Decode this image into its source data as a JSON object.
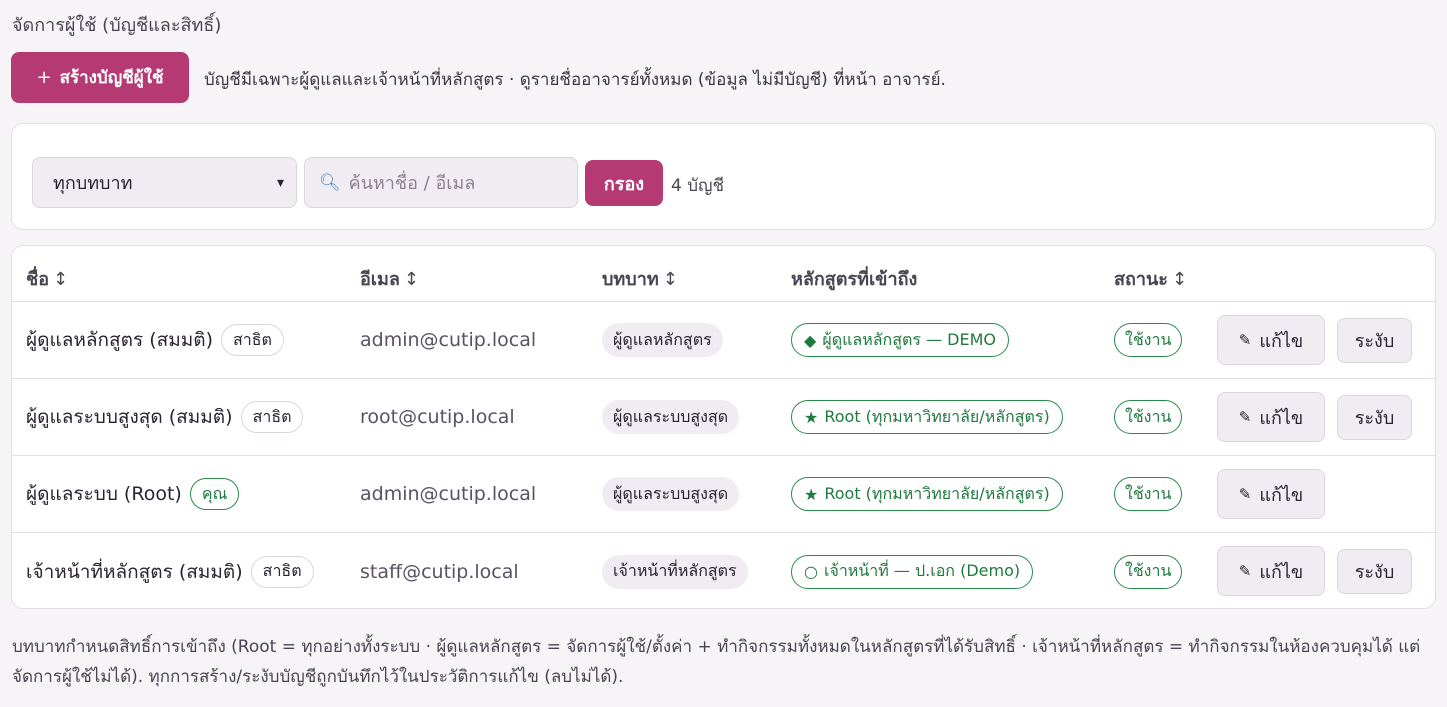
{
  "page": {
    "heading": "จัดการผู้ใช้ (บัญชีและสิทธิ์)",
    "create_icon": "plus-icon",
    "create_label": "สร้างบัญชีผู้ใช้",
    "intro": "บัญชีมีเฉพาะผู้ดูแลและเจ้าหน้าที่หลักสูตร · ดูรายชื่ออาจารย์ทั้งหมด (ข้อมูล ไม่มีบัญชี) ที่หน้า อาจารย์.",
    "footer": "บทบาทกำหนดสิทธิ์การเข้าถึง (Root = ทุกอย่างทั้งระบบ · ผู้ดูแลหลักสูตร = จัดการผู้ใช้/ตั้งค่า + ทำกิจกรรมทั้งหมดในหลักสูตรที่ได้รับสิทธิ์ · เจ้าหน้าที่หลักสูตร = ทำกิจกรรมในห้องควบคุมได้ แต่จัดการผู้ใช้ไม่ได้). ทุกการสร้าง/ระงับบัญชีถูกบันทึกไว้ในประวัติการแก้ไข (ลบไม่ได้)."
  },
  "filters": {
    "role_selected": "ทุกบทบาท",
    "search_placeholder": "ค้นหาชื่อ / อีเมล",
    "filter_label": "กรอง",
    "count": "4 บัญชี"
  },
  "table": {
    "headers": {
      "name": "ชื่อ",
      "email": "อีเมล",
      "role": "บทบาท",
      "courses": "หลักสูตรที่เข้าถึง",
      "status": "สถานะ",
      "sort_glyph": "↕"
    },
    "edit_label": "แก้ไข",
    "suspend_label": "ระงับ",
    "rows": [
      {
        "name": "ผู้ดูแลหลักสูตร (สมมติ)",
        "tag": "สาธิต",
        "email": "admin@cutip.local",
        "role": "ผู้ดูแลหลักสูตร",
        "course_glyph": "◆",
        "course": "ผู้ดูแลหลักสูตร — DEMO",
        "status": "ใช้งาน"
      },
      {
        "name": "ผู้ดูแลระบบสูงสุด (สมมติ)",
        "tag": "สาธิต",
        "email": "root@cutip.local",
        "role": "ผู้ดูแลระบบสูงสุด",
        "course_glyph": "★",
        "course": "Root (ทุกมหาวิทยาลัย/หลักสูตร)",
        "status": "ใช้งาน"
      },
      {
        "name": "ผู้ดูแลระบบ (Root)",
        "tag": "คุณ",
        "email": "admin@cutip.local",
        "role": "ผู้ดูแลระบบสูงสุด",
        "course_glyph": "★",
        "course": "Root (ทุกมหาวิทยาลัย/หลักสูตร)",
        "status": "ใช้งาน"
      },
      {
        "name": "เจ้าหน้าที่หลักสูตร (สมมติ)",
        "tag": "สาธิต",
        "email": "staff@cutip.local",
        "role": "เจ้าหน้าที่หลักสูตร",
        "course_glyph": "○",
        "course": "เจ้าหน้าที่ — ป.เอก (Demo)",
        "status": "ใช้งาน"
      }
    ]
  }
}
